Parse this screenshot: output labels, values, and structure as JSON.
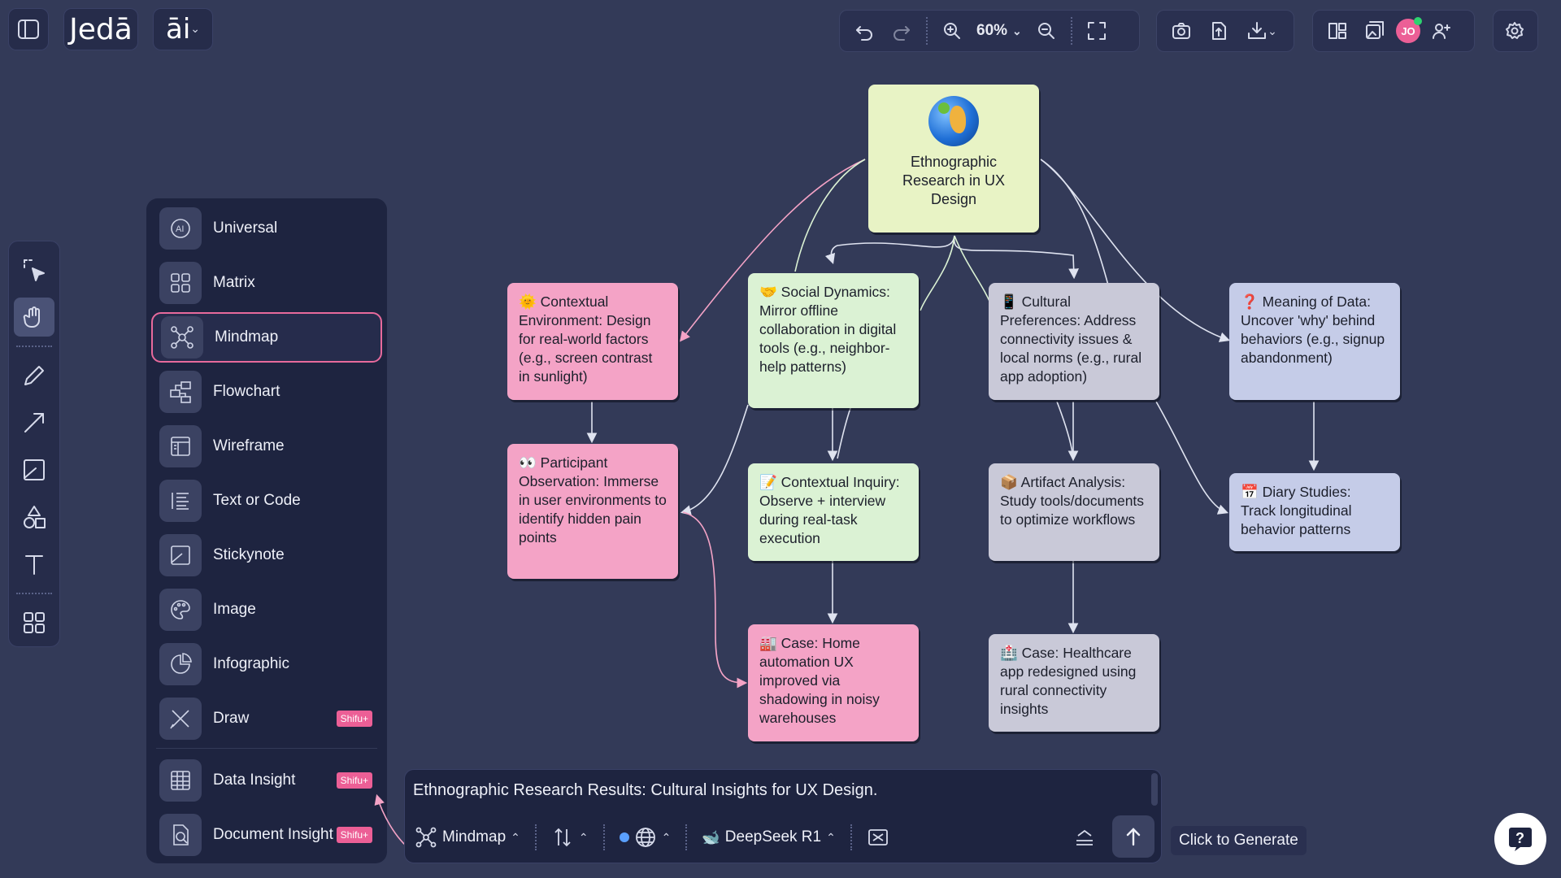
{
  "header": {
    "logo_text": "Jedā",
    "ai_label": "āi",
    "zoom": "60%"
  },
  "menu": {
    "items": [
      {
        "label": "Universal"
      },
      {
        "label": "Matrix"
      },
      {
        "label": "Mindmap"
      },
      {
        "label": "Flowchart"
      },
      {
        "label": "Wireframe"
      },
      {
        "label": "Text or Code"
      },
      {
        "label": "Stickynote"
      },
      {
        "label": "Image"
      },
      {
        "label": "Infographic"
      },
      {
        "label": "Draw",
        "badge": "Shifu+"
      },
      {
        "label": "Data Insight",
        "badge": "Shifu+"
      },
      {
        "label": "Document Insight",
        "badge": "Shifu+"
      }
    ]
  },
  "mindmap": {
    "root": "Ethnographic Research in UX Design",
    "nodes": [
      {
        "text": "🌞 Contextual Environment: Design for real-world factors (e.g., screen contrast in sunlight)"
      },
      {
        "text": "🤝 Social Dynamics: Mirror offline collaboration in digital tools (e.g., neighbor-help patterns)"
      },
      {
        "text": "📱 Cultural Preferences: Address connectivity issues & local norms (e.g., rural app adoption)"
      },
      {
        "text": "❓ Meaning of Data: Uncover 'why' behind behaviors (e.g., signup abandonment)"
      },
      {
        "text": "👀 Participant Observation: Immerse in user environments to identify hidden pain points"
      },
      {
        "text": "📝 Contextual Inquiry: Observe + interview during real-task execution"
      },
      {
        "text": "📦 Artifact Analysis: Study tools/documents to optimize workflows"
      },
      {
        "text": "📅 Diary Studies: Track longitudinal behavior patterns"
      },
      {
        "text": "🏭 Case: Home automation UX improved via shadowing in noisy warehouses"
      },
      {
        "text": "🏥 Case: Healthcare app redesigned using rural connectivity insights"
      }
    ]
  },
  "prompt": {
    "text": "Ethnographic Research Results: Cultural Insights for UX Design.",
    "mode": "Mindmap",
    "model": "DeepSeek R1",
    "tooltip": "Click to Generate"
  },
  "user": {
    "initials": "JO"
  },
  "colors": {
    "accent": "#ec5f96",
    "background": "#333a58",
    "panel": "#1e2440"
  }
}
